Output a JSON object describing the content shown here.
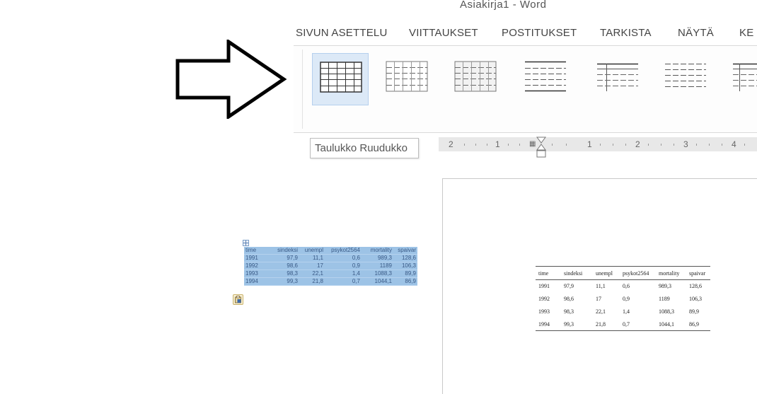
{
  "window": {
    "title": "Asiakirja1 - Word"
  },
  "ribbon": {
    "tabs": [
      "SIVUN ASETTELU",
      "VIITTAUKSET",
      "POSTITUKSET",
      "TARKISTA",
      "NÄYTÄ",
      "KE"
    ]
  },
  "tooltip": {
    "text": "Taulukko Ruudukko"
  },
  "ruler": {
    "labels": [
      "2",
      "1",
      "1",
      "2",
      "3",
      "4"
    ]
  },
  "table": {
    "headers": [
      "time",
      "sindeksi",
      "unempl",
      "psykot2564",
      "mortality",
      "spaivar"
    ],
    "rows": [
      [
        "1991",
        "97,9",
        "11,1",
        "0,6",
        "989,3",
        "128,6"
      ],
      [
        "1992",
        "98,6",
        "17",
        "0,9",
        "1189",
        "106,3"
      ],
      [
        "1993",
        "98,3",
        "22,1",
        "1,4",
        "1088,3",
        "89,9"
      ],
      [
        "1994",
        "99,3",
        "21,8",
        "0,7",
        "1044,1",
        "86,9"
      ]
    ]
  },
  "icons": {
    "arrow": "right-arrow-outline-icon",
    "move_handle": "table-move-handle-icon",
    "paste_options": "paste-options-icon",
    "indent": "indent-marker-icon"
  },
  "colors": {
    "selection": "#9dc3e6",
    "selected_style": "#dce9f7",
    "ruler": "#e8e8e8"
  }
}
